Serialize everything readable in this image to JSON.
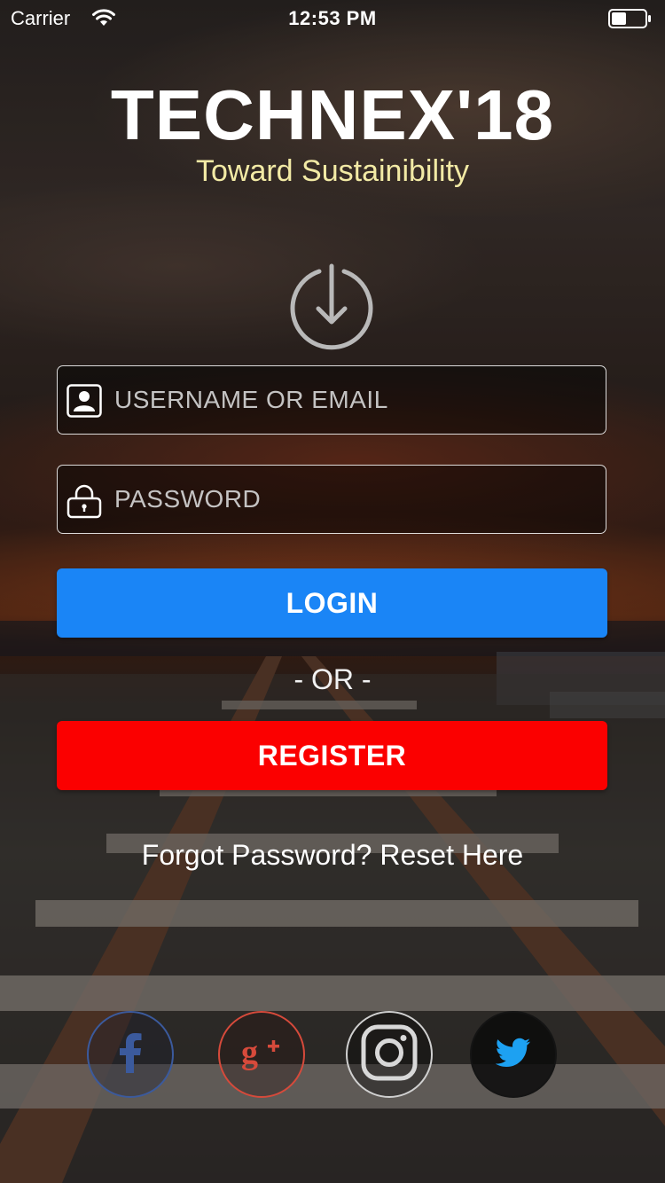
{
  "status_bar": {
    "carrier": "Carrier",
    "time": "12:53 PM",
    "wifi_icon": "wifi-icon",
    "battery_icon": "battery-icon"
  },
  "header": {
    "title": "TECHNEX'18",
    "subtitle": "Toward Sustainibility"
  },
  "login_form": {
    "logo_icon": "power-download-icon",
    "username": {
      "placeholder": "USERNAME OR EMAIL",
      "value": "",
      "icon": "user-card-icon"
    },
    "password": {
      "placeholder": "PASSWORD",
      "value": "",
      "icon": "lock-icon"
    },
    "login_label": "LOGIN",
    "or_label": "- OR -",
    "register_label": "REGISTER",
    "forgot_label": "Forgot Password? Reset Here"
  },
  "social": [
    {
      "name": "facebook",
      "icon": "facebook-icon",
      "color": "#3b5a9d"
    },
    {
      "name": "google-plus",
      "icon": "google-plus-icon",
      "color": "#d64a3b"
    },
    {
      "name": "instagram",
      "icon": "instagram-icon",
      "color": "#d0d0d0"
    },
    {
      "name": "twitter",
      "icon": "twitter-icon",
      "color": "#1da1f2"
    }
  ],
  "colors": {
    "login_button": "#1a85f6",
    "register_button": "#fb0000",
    "subtitle": "#f2eaa5"
  }
}
